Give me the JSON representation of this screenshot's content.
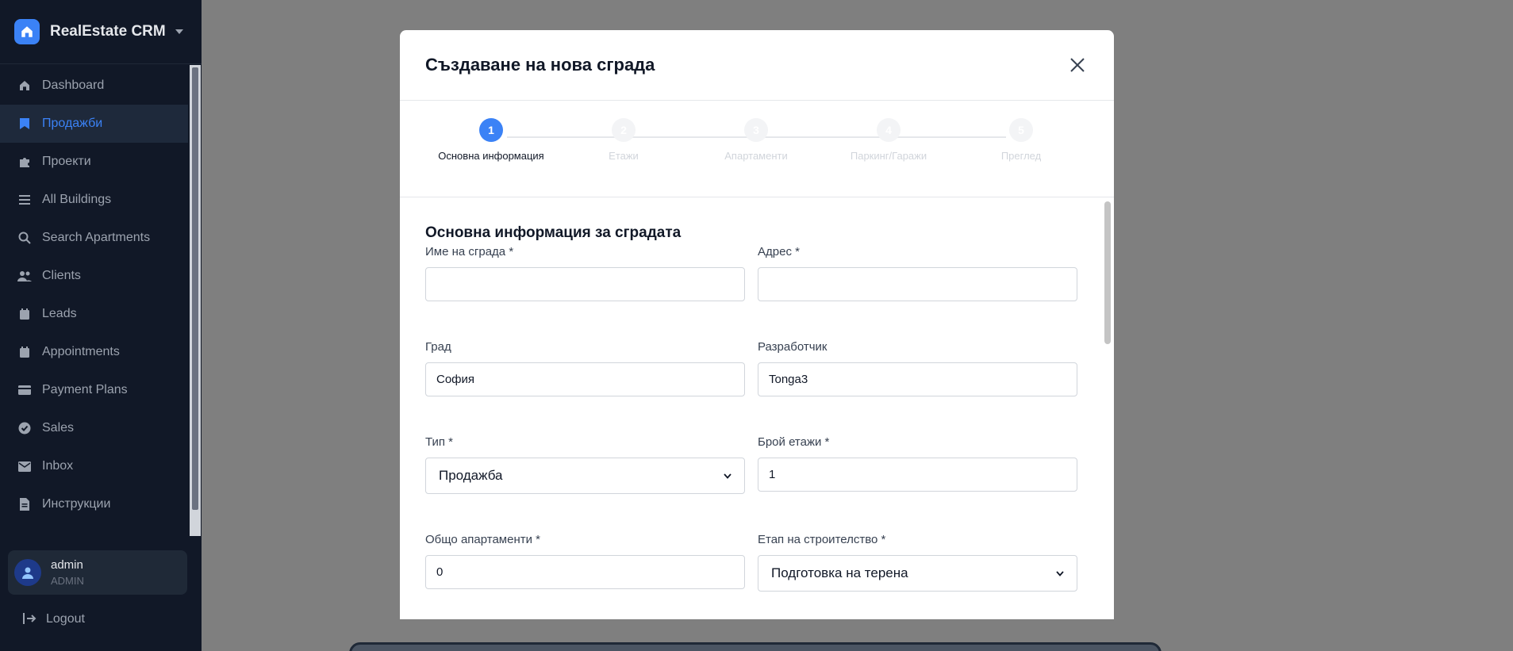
{
  "app": {
    "name": "RealEstate CRM"
  },
  "sidebar": {
    "items": [
      {
        "label": "Dashboard",
        "icon": "home-icon"
      },
      {
        "label": "Продажби",
        "icon": "bookmark-icon",
        "active": true
      },
      {
        "label": "Проекти",
        "icon": "puzzle-icon"
      },
      {
        "label": "All Buildings",
        "icon": "list-icon"
      },
      {
        "label": "Search Apartments",
        "icon": "search-icon"
      },
      {
        "label": "Clients",
        "icon": "users-icon"
      },
      {
        "label": "Leads",
        "icon": "calendar-icon"
      },
      {
        "label": "Appointments",
        "icon": "calendar-icon"
      },
      {
        "label": "Payment Plans",
        "icon": "credit-card-icon"
      },
      {
        "label": "Sales",
        "icon": "check-circle-icon"
      },
      {
        "label": "Inbox",
        "icon": "inbox-icon"
      },
      {
        "label": "Инструкции",
        "icon": "document-icon"
      }
    ],
    "user": {
      "name": "admin",
      "role": "ADMIN"
    },
    "logout_label": "Logout"
  },
  "modal": {
    "title": "Създаване на нова сграда",
    "steps": [
      {
        "number": "1",
        "label": "Основна информация",
        "active": true
      },
      {
        "number": "2",
        "label": "Етажи"
      },
      {
        "number": "3",
        "label": "Апартаменти"
      },
      {
        "number": "4",
        "label": "Паркинг/Гаражи"
      },
      {
        "number": "5",
        "label": "Преглед"
      }
    ],
    "section_title": "Основна информация за сградата",
    "fields": {
      "building_name": {
        "label": "Име на сграда *",
        "value": ""
      },
      "address": {
        "label": "Адрес *",
        "value": ""
      },
      "city": {
        "label": "Град",
        "value": "София"
      },
      "developer": {
        "label": "Разработчик",
        "value": "Tonga3"
      },
      "type": {
        "label": "Тип *",
        "value": "Продажба"
      },
      "floors": {
        "label": "Брой етажи *",
        "value": "1"
      },
      "total_apartments": {
        "label": "Общо апартаменти *",
        "value": "0"
      },
      "construction_stage": {
        "label": "Етап на строителство *",
        "value": "Подготовка на терена"
      }
    }
  },
  "colors": {
    "accent": "#3b82f6",
    "sidebar_bg": "#111827",
    "overlay": "#7f7f7f"
  }
}
